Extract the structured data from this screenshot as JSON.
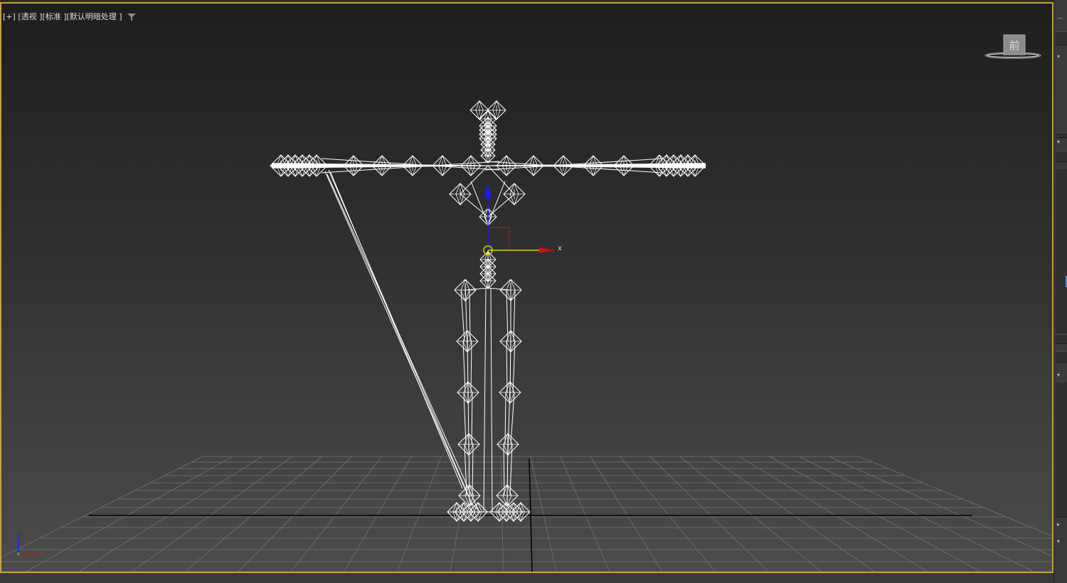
{
  "viewport": {
    "label": {
      "plus": "[+]",
      "view": "[透视 ]",
      "shading": "[标准 ]",
      "lighting": "[默认明暗处理 ]"
    },
    "viewcube_face": "前",
    "gizmo_x_label": "x",
    "axis_tripod": {
      "x": "x",
      "z": "z"
    },
    "active_border_color": "#c8a043",
    "filter_icon": "funnel-icon"
  },
  "colors": {
    "x_axis": "#d01010",
    "y_axis": "#d4d400",
    "z_axis": "#1a1aff",
    "wire": "#ffffff",
    "grid": "#6a6a6a"
  }
}
